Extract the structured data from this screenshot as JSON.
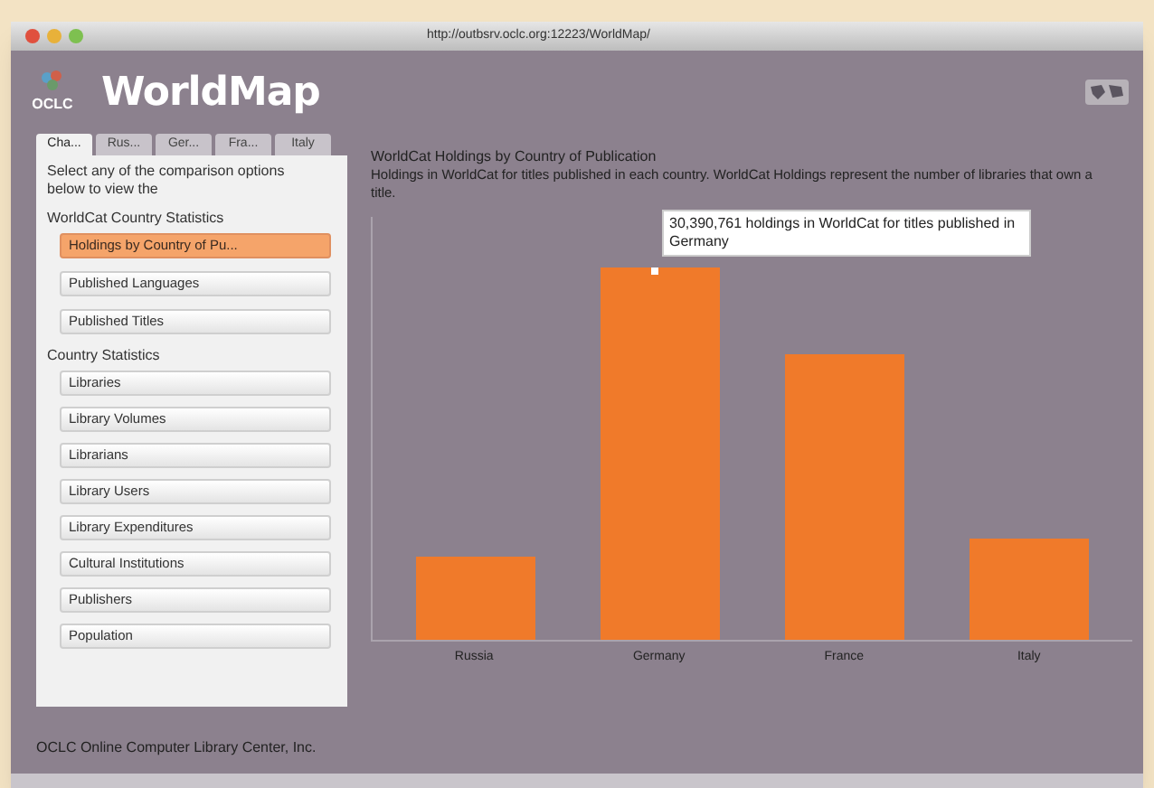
{
  "window": {
    "url": "http://outbsrv.oclc.org:12223/WorldMap/"
  },
  "header": {
    "logo_text": "OCLC",
    "title": "WorldMap"
  },
  "tabs": [
    {
      "label": "Cha...",
      "selected": true
    },
    {
      "label": "Rus...",
      "selected": false
    },
    {
      "label": "Ger...",
      "selected": false
    },
    {
      "label": "Fra...",
      "selected": false
    },
    {
      "label": "Italy",
      "selected": false
    }
  ],
  "panel": {
    "intro": "Select any of the comparison options below to view the",
    "sections": [
      {
        "heading": "WorldCat Country Statistics",
        "items": [
          {
            "label": "Holdings by Country of Pu...",
            "selected": true
          },
          {
            "label": "Published Languages",
            "selected": false
          },
          {
            "label": "Published Titles",
            "selected": false
          }
        ]
      },
      {
        "heading": "Country Statistics",
        "items": [
          {
            "label": "Libraries",
            "selected": false
          },
          {
            "label": "Library Volumes",
            "selected": false
          },
          {
            "label": "Librarians",
            "selected": false
          },
          {
            "label": "Library Users",
            "selected": false
          },
          {
            "label": "Library Expenditures",
            "selected": false
          },
          {
            "label": "Cultural Institutions",
            "selected": false
          },
          {
            "label": "Publishers",
            "selected": false
          },
          {
            "label": "Population",
            "selected": false
          }
        ]
      }
    ]
  },
  "chart": {
    "title": "WorldCat Holdings by Country of Publication",
    "description": "Holdings in WorldCat for titles published in each country. WorldCat Holdings represent the number of libraries that own a title.",
    "tooltip": "30,390,761 holdings in WorldCat for titles published in Germany",
    "categories": [
      "Russia",
      "Germany",
      "France",
      "Italy"
    ]
  },
  "footer": "OCLC Online Computer Library Center, Inc."
}
